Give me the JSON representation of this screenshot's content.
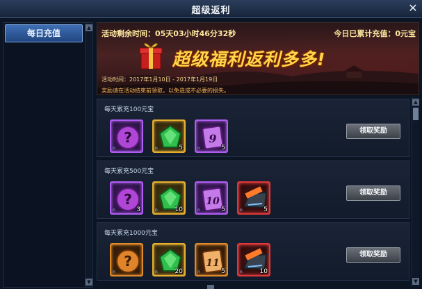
{
  "window": {
    "title": "超级返利",
    "close": "✕"
  },
  "sidebar": {
    "items": [
      {
        "label": "每日充值"
      }
    ]
  },
  "banner": {
    "countdown": "活动剩余时间：05天03小时46分32秒",
    "charged": "今日已累计充值：0元宝",
    "slogan": "超级福利返利多多!",
    "period": "活动时间：2017年1月10日 - 2017年1月19日",
    "notice": "奖励请在活动结束前领取，以免造成不必要的损失。"
  },
  "tiers": [
    {
      "title": "每天累充100元宝",
      "button": "领取奖励",
      "rewards": [
        {
          "icon": "mystery-orb-icon",
          "frame": "purple",
          "symbol": "?",
          "count": "",
          "bind": "n"
        },
        {
          "icon": "green-gem-icon",
          "frame": "green",
          "symbol": "",
          "count": "5",
          "bind": "n"
        },
        {
          "icon": "scroll-9-icon",
          "frame": "purple",
          "symbol": "9",
          "count": "5",
          "bind": "n"
        }
      ]
    },
    {
      "title": "每天累充500元宝",
      "button": "领取奖励",
      "rewards": [
        {
          "icon": "mystery-orb-icon",
          "frame": "purple",
          "symbol": "?",
          "count": "3",
          "bind": "n"
        },
        {
          "icon": "green-gem-icon",
          "frame": "green",
          "symbol": "",
          "count": "10",
          "bind": "n"
        },
        {
          "icon": "scroll-10-icon",
          "frame": "purple",
          "symbol": "10",
          "count": "5",
          "bind": "n"
        },
        {
          "icon": "equipment-chest-icon",
          "frame": "red",
          "symbol": "",
          "count": "5",
          "bind": "n"
        }
      ]
    },
    {
      "title": "每天累充1000元宝",
      "button": "领取奖励",
      "rewards": [
        {
          "icon": "mystery-orb-icon",
          "frame": "orange",
          "symbol": "?",
          "count": "",
          "bind": "n"
        },
        {
          "icon": "green-gem-icon",
          "frame": "green",
          "symbol": "",
          "count": "20",
          "bind": "n"
        },
        {
          "icon": "scroll-11-icon",
          "frame": "orange",
          "symbol": "11",
          "count": "5",
          "bind": "n"
        },
        {
          "icon": "equipment-chest-icon",
          "frame": "red",
          "symbol": "",
          "count": "10",
          "bind": "n"
        }
      ]
    }
  ],
  "colors": {
    "accent": "#ffd84a",
    "purple_frame": "#b05cf5",
    "gold_frame": "#e9b02c",
    "orange_frame": "#e08a2a",
    "red_frame": "#e0383a"
  }
}
